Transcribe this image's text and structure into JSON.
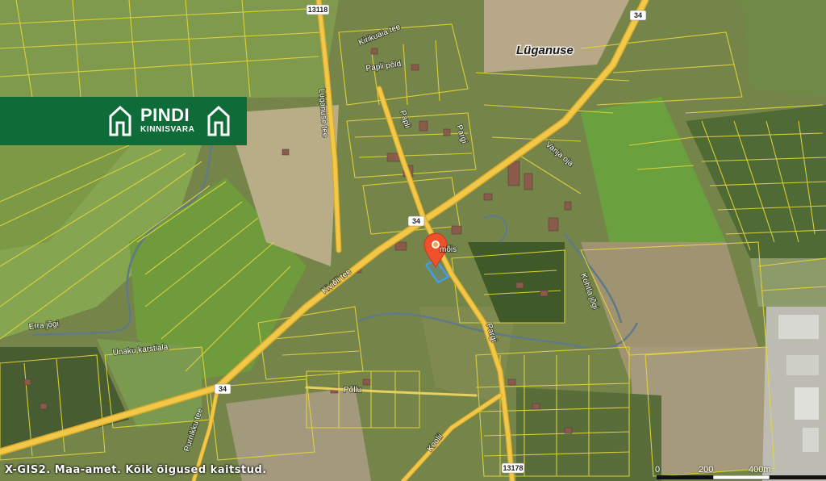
{
  "map": {
    "place_name": "Lüganuse",
    "estate_label": "mõis",
    "copyright": "X-GIS2. Maa-amet. Kõik õigused kaitstud.",
    "roads": {
      "kivioli_tee": "Kiviõli tee",
      "luganuse_tee": "Lüganuse tee",
      "papli_pold": "Papli põld",
      "kirikuaia_tee": "Kirikuaia tee",
      "papli": "Papli",
      "pargi": "Pargi",
      "pargi_lower": "Pargi",
      "koolii": "Koolii",
      "pollu": "Põllu",
      "purnikku_tee": "Purnikku tee"
    },
    "waters": {
      "erra_jogi": "Erra jõgi",
      "vanja_oja": "Vanja oja",
      "kohtla_jogi": "Kohtla jõgi",
      "unaku_karstiala": "Unaku karstiala"
    },
    "route_shields": {
      "r34_left": "34",
      "r34_center": "34",
      "r34_top": "34",
      "r13118": "13118",
      "r13178": "13178"
    },
    "scale": {
      "labels": [
        "0",
        "200",
        "400m"
      ]
    },
    "marker": {
      "label": "Location"
    }
  },
  "logo": {
    "title": "PINDI",
    "subtitle": "KINNISVARA",
    "background": "#0f6b37"
  },
  "colors": {
    "parcel_lines": "#e6d63a",
    "main_road": "#f2c84b",
    "marker": "#f0502a",
    "highlight_parcel": "#3aa0ff"
  }
}
